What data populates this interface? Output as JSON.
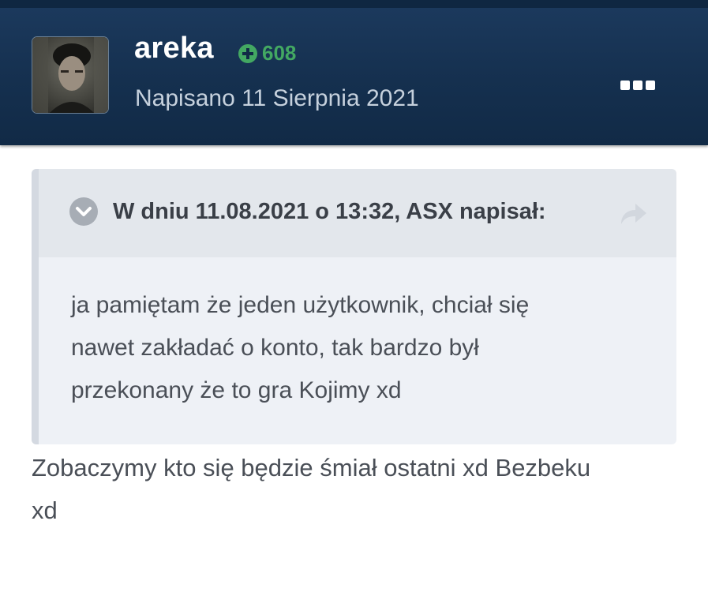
{
  "post": {
    "author": "areka",
    "reputation": "608",
    "date": "Napisano 11 Sierpnia 2021",
    "avatar_icon": "user-avatar",
    "more_icon": "more-dots-icon"
  },
  "quote": {
    "citation": "W dniu 11.08.2021 o 13:32, ASX napisał:",
    "lines": [
      "ja pamiętam że jeden użytkownik, chciał się",
      "nawet zakładać o konto, tak bardzo był",
      "przekonany że to gra Kojimy xd"
    ]
  },
  "reply": {
    "lines": [
      "Zobaczymy kto się będzie śmiał ostatni xd Bezbeku",
      "xd"
    ]
  },
  "colors": {
    "header": "#15304f",
    "reputation": "#43a862",
    "quote_bg": "#eef1f6",
    "quote_head": "#e3e7ec"
  }
}
